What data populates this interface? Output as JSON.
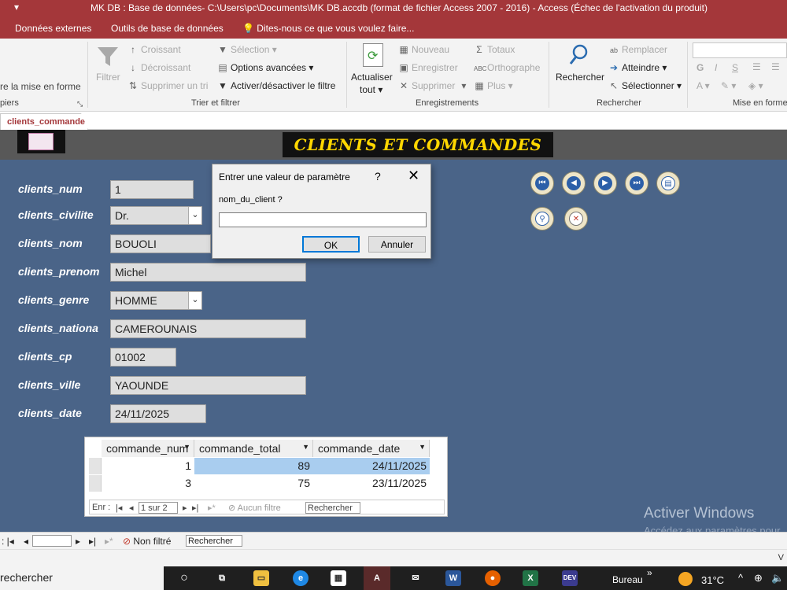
{
  "window": {
    "quick_access": "▾",
    "title": "MK DB : Base de données- C:\\Users\\pc\\Documents\\MK DB.accdb (format de fichier Access 2007 - 2016) - Access (Échec de l'activation du produit)"
  },
  "menu": {
    "external_data": "Données externes",
    "db_tools": "Outils de base de données",
    "tell_me": "Dites-nous ce que vous voulez faire..."
  },
  "ribbon": {
    "painter": "re la mise en forme",
    "clipboard_group": "piers",
    "filter": "Filtrer",
    "ascending": "Croissant",
    "descending": "Décroissant",
    "remove_sort": "Supprimer un tri",
    "selection": "Sélection ▾",
    "advanced": "Options avancées ▾",
    "toggle_filter": "Activer/désactiver le filtre",
    "sort_filter_group": "Trier et filtrer",
    "refresh": "Actualiser",
    "refresh_all": "tout ▾",
    "new": "Nouveau",
    "save": "Enregistrer",
    "delete": "Supprimer",
    "totals": "Totaux",
    "spelling": "Orthographe",
    "more": "Plus ▾",
    "records_group": "Enregistrements",
    "find": "Rechercher",
    "replace": "Remplacer",
    "goto": "Atteindre ▾",
    "select": "Sélectionner ▾",
    "find_group": "Rechercher",
    "text_format_group": "Mise en forme",
    "bold": "G",
    "italic": "I",
    "underline": "S"
  },
  "tab": {
    "label": "clients_commande"
  },
  "form": {
    "banner": "CLIENTS ET COMMANDES",
    "fields": {
      "num_label": "clients_num",
      "num": "1",
      "civilite_label": "clients_civilite",
      "civilite": "Dr.",
      "nom_label": "clients_nom",
      "nom": "BOUOLI",
      "prenom_label": "clients_prenom",
      "prenom": "Michel",
      "genre_label": "clients_genre",
      "genre": "HOMME",
      "nationa_label": "clients_nationa",
      "nationa": "CAMEROUNAIS",
      "cp_label": "clients_cp",
      "cp": "01002",
      "ville_label": "clients_ville",
      "ville": "YAOUNDE",
      "date_label": "clients_date",
      "date": "24/11/2025"
    }
  },
  "subform": {
    "headers": [
      "commande_num",
      "commande_total",
      "commande_date"
    ],
    "rows": [
      [
        "1",
        "89",
        "24/11/2025"
      ],
      [
        "3",
        "75",
        "23/11/2025"
      ]
    ],
    "nav": {
      "prefix": "Enr :",
      "position": "1 sur 2",
      "no_filter": "Aucun filtre",
      "search": "Rechercher"
    }
  },
  "record_bar": {
    "not_filtered": "Non filtré",
    "search": "Rechercher"
  },
  "dialog": {
    "title": "Entrer une valeur de paramètre",
    "help": "?",
    "close": "✕",
    "prompt": "nom_du_client ?",
    "value": "",
    "ok": "OK",
    "cancel": "Annuler"
  },
  "watermark": {
    "line1": "Activer Windows",
    "line2": "Accédez aux paramètres pour"
  },
  "taskbar": {
    "search": "rechercher",
    "desktop": "Bureau",
    "chevron": "»",
    "temp": "31°C"
  },
  "colors": {
    "access_red": "#a4373a",
    "form_blue": "#4a6488",
    "banner_yellow": "#ffd700"
  }
}
